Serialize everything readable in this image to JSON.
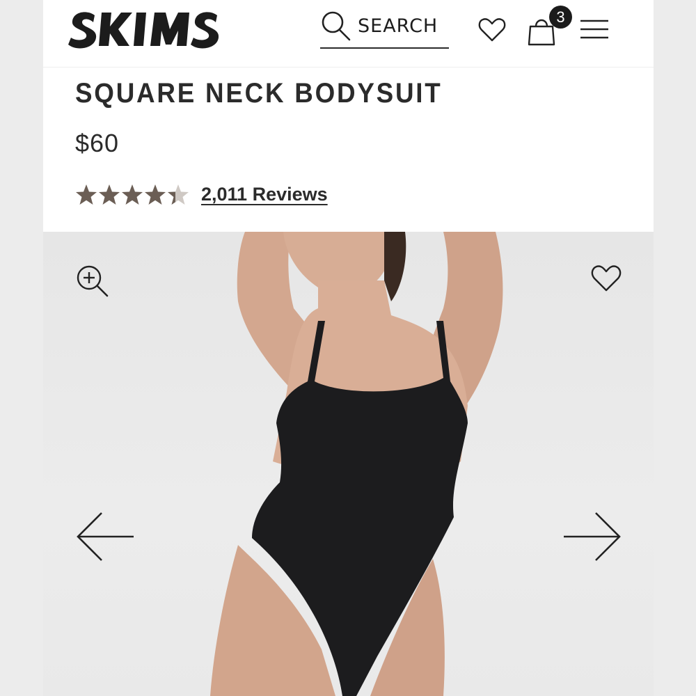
{
  "header": {
    "brand": "SKIMS",
    "search_label": "SEARCH",
    "cart_count": "3",
    "icons": {
      "search": "search-icon",
      "wishlist": "heart-icon",
      "cart": "shopping-bag-icon",
      "menu": "hamburger-menu-icon"
    }
  },
  "product": {
    "title": "SQUARE NECK BODYSUIT",
    "price": "$60",
    "rating": {
      "value": 4.5,
      "max": 5,
      "reviews_label": "2,011 Reviews"
    }
  },
  "gallery": {
    "icons": {
      "zoom": "zoom-in-icon",
      "favorite": "heart-icon",
      "previous": "arrow-left-icon",
      "next": "arrow-right-icon"
    }
  },
  "colors": {
    "text": "#2b2b2b",
    "star": "#6b5e55",
    "background": "#ffffff",
    "gallery_bg": "#e9e9e9",
    "badge": "#1b1b1b"
  }
}
